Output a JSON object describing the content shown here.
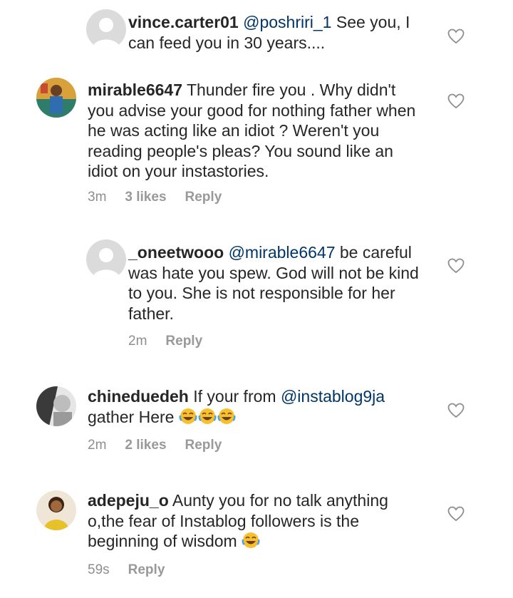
{
  "comments": [
    {
      "username": "vince.carter01",
      "mention": "@poshriri_1",
      "text": " See you, I can feed you in 30 years....",
      "avatar": "default-avatar",
      "reply_label": ""
    },
    {
      "username": "mirable6647",
      "text": " Thunder fire you . Why didn't you advise your good for nothing father when he was acting like an idiot ? Weren't you reading people's pleas? You sound like an idiot on your instastories.",
      "time": "3m",
      "likes": "3 likes",
      "reply_label": "Reply",
      "avatar": "photo-avatar"
    },
    {
      "username": "_oneetwooo",
      "mention": "@mirable6647",
      "text": " be careful was hate you spew. God will not be kind to you. She is not responsible for her father.",
      "time": "2m",
      "reply_label": "Reply",
      "avatar": "default-avatar"
    },
    {
      "username": "chineduedeh",
      "text_before": " If your from ",
      "mention": "@instablog9ja",
      "text_after": " gather Here",
      "emoji": "face-with-tears-of-joy",
      "time": "2m",
      "likes": "2 likes",
      "reply_label": "Reply",
      "avatar": "photo-avatar"
    },
    {
      "username": "adepeju_o",
      "text": " Aunty you for no talk anything o,the fear of Instablog followers is the beginning of wisdom",
      "emoji": "face-with-tears-of-joy",
      "time": "59s",
      "reply_label": "Reply",
      "avatar": "photo-avatar"
    }
  ],
  "colors": {
    "text": "#262626",
    "mention": "#003569",
    "meta": "#8e8e8e",
    "heart_stroke": "#8e8e8e",
    "emoji_face": "#f7c02c"
  },
  "icons": {
    "like": "heart-outline-icon",
    "emoji": "face-with-tears-of-joy"
  }
}
